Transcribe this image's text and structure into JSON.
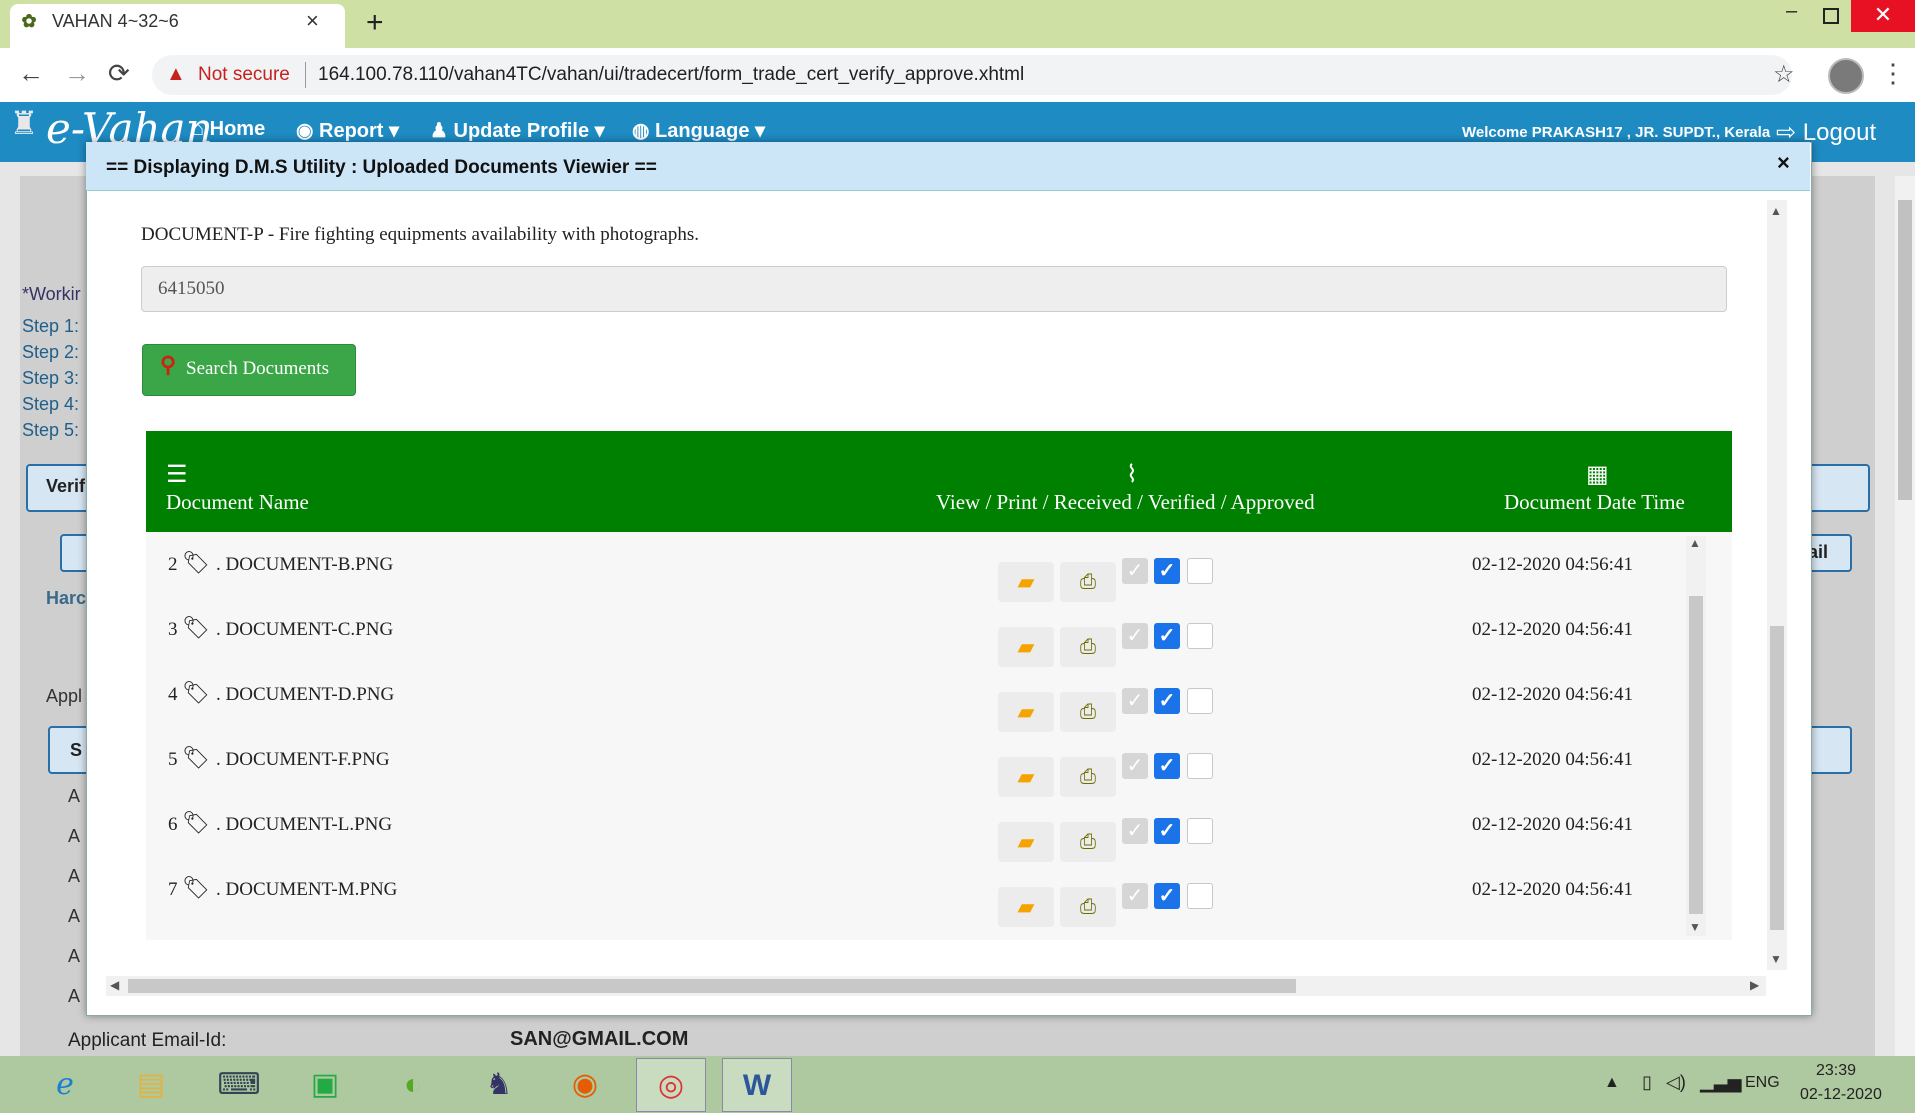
{
  "browser": {
    "tab_title": "VAHAN 4~32~6",
    "tab_close": "×",
    "new_tab": "+",
    "security_label": "Not secure",
    "url": "164.100.78.110/vahan4TC/vahan/ui/tradecert/form_trade_cert_verify_approve.xhtml",
    "nav_back": "←",
    "nav_forward": "→",
    "nav_reload": "⟳",
    "star": "☆",
    "menu": "⋮",
    "win_min": "–",
    "win_close": "✕"
  },
  "app": {
    "logo_text": "e-Vahan",
    "nav": [
      {
        "label": "Home",
        "icon": "home-icon"
      },
      {
        "label": "Report ▾",
        "icon": "report-icon"
      },
      {
        "label": "Update Profile ▾",
        "icon": "user-icon"
      },
      {
        "label": "Language ▾",
        "icon": "globe-icon"
      }
    ],
    "welcome": "Welcome PRAKASH17 , JR. SUPDT., Kerala",
    "logout": "Logout"
  },
  "background_page": {
    "working_label": "*Workir",
    "steps": [
      "Step 1:",
      "Step 2:",
      "Step 3:",
      "Step 4:",
      "Step 5:"
    ],
    "verify_label": "Verif",
    "hard_label": "Harc",
    "appl_label": "Appl",
    "s_label": "S",
    "a_labels": [
      "A",
      "A",
      "A",
      "A",
      "A",
      "A"
    ],
    "mail_label": "ail",
    "email_label": "Applicant Email-Id:",
    "email_value": "SAN@GMAIL.COM"
  },
  "modal": {
    "title": "== Displaying D.M.S Utility : Uploaded Documents Viewier ==",
    "close": "×",
    "doc_description": "DOCUMENT-P - Fire fighting equipments availability with photographs.",
    "appl_no_value": "6415050",
    "search_button": "Search Documents",
    "columns": {
      "name": "Document Name",
      "actions": "View / Print / Received / Verified / Approved",
      "date": "Document Date Time"
    },
    "rows": [
      {
        "num": "2",
        "name": ". DOCUMENT-B.PNG",
        "date": "02-12-2020 04:56:41",
        "received": true,
        "verified": true,
        "approved": false
      },
      {
        "num": "3",
        "name": ". DOCUMENT-C.PNG",
        "date": "02-12-2020 04:56:41",
        "received": true,
        "verified": true,
        "approved": false
      },
      {
        "num": "4",
        "name": ". DOCUMENT-D.PNG",
        "date": "02-12-2020 04:56:41",
        "received": true,
        "verified": true,
        "approved": false
      },
      {
        "num": "5",
        "name": ". DOCUMENT-F.PNG",
        "date": "02-12-2020 04:56:41",
        "received": true,
        "verified": true,
        "approved": false
      },
      {
        "num": "6",
        "name": ". DOCUMENT-L.PNG",
        "date": "02-12-2020 04:56:41",
        "received": true,
        "verified": true,
        "approved": false
      },
      {
        "num": "7",
        "name": ". DOCUMENT-M.PNG",
        "date": "02-12-2020 04:56:41",
        "received": true,
        "verified": true,
        "approved": false
      }
    ]
  },
  "taskbar": {
    "apps": [
      "internet-explorer",
      "file-explorer",
      "network-app",
      "app-4",
      "dreamweaver",
      "postgresql",
      "firefox",
      "chrome",
      "word"
    ],
    "lang": "ENG",
    "time": "23:39",
    "date": "02-12-2020"
  }
}
